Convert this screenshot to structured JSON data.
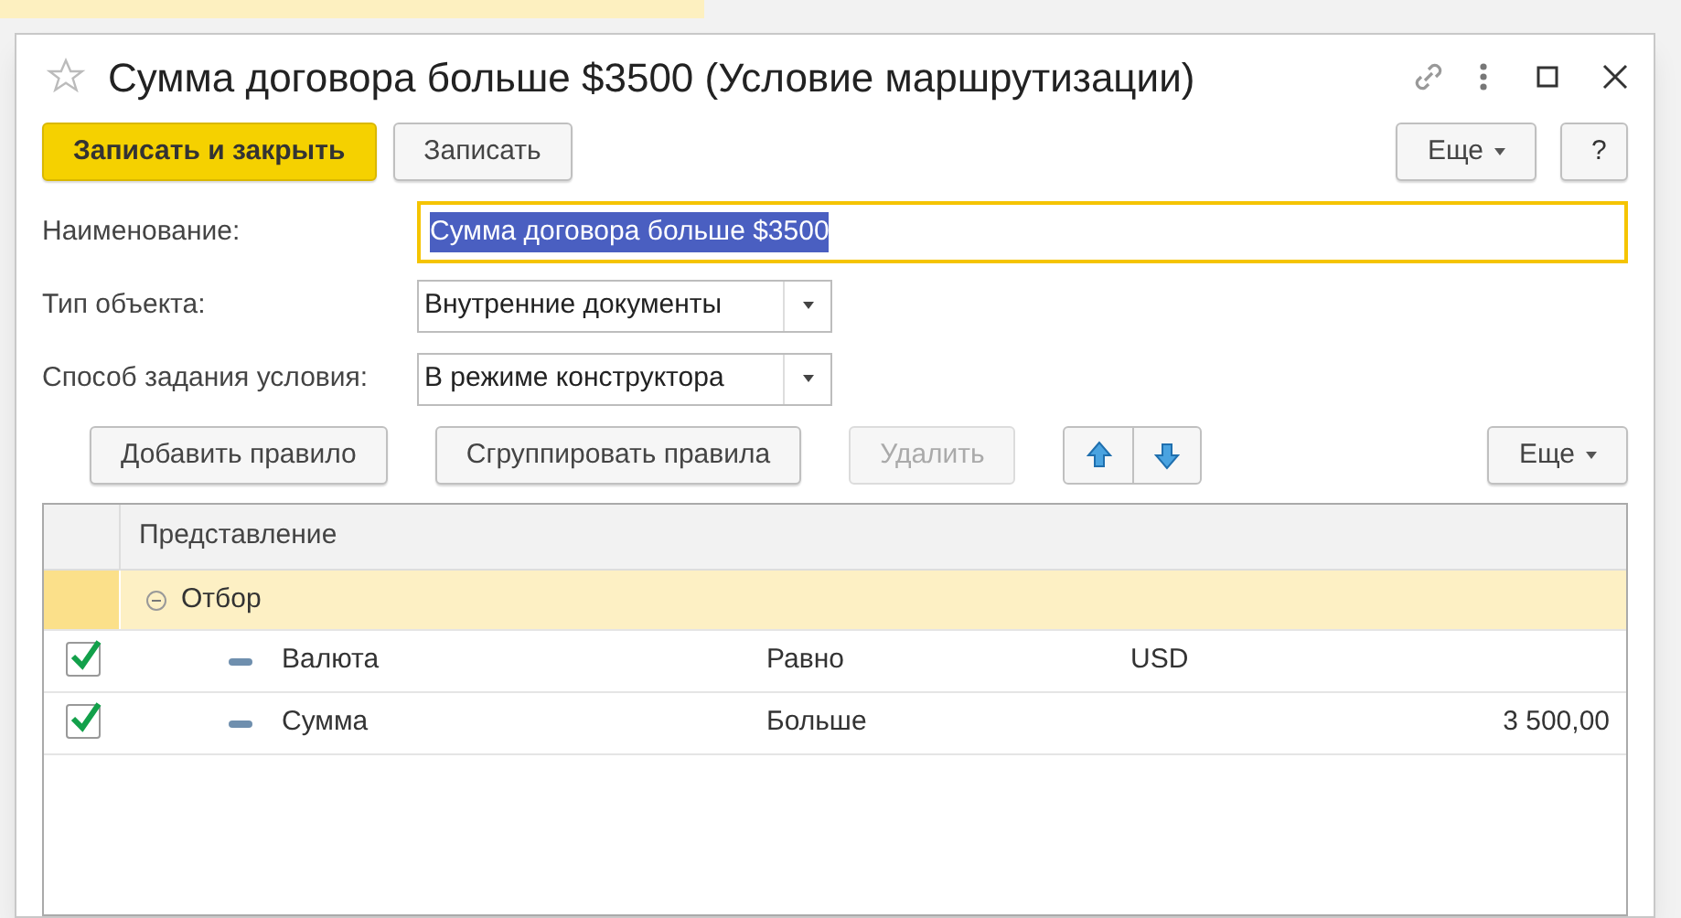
{
  "window": {
    "title": "Сумма договора больше $3500 (Условие маршрутизации)"
  },
  "toolbar": {
    "buttons": [
      {
        "label": "Записать и закрыть",
        "kind": "primary"
      },
      {
        "label": "Записать",
        "kind": "normal"
      }
    ],
    "more": "Еще",
    "help": "?"
  },
  "fields": [
    {
      "label": "Наименование:",
      "kind": "text",
      "value": "Сумма договора больше $3500",
      "focused": true
    },
    {
      "label": "Тип объекта:",
      "kind": "select",
      "value": "Внутренние документы",
      "focused": false
    },
    {
      "label": "Способ задания условия:",
      "kind": "select",
      "value": "В режиме конструктора",
      "focused": false
    }
  ],
  "rules_toolbar": {
    "buttons": [
      {
        "label": "Добавить правило",
        "disabled": false
      },
      {
        "label": "Сгруппировать правила",
        "disabled": false
      },
      {
        "label": "Удалить",
        "disabled": true
      }
    ],
    "more": "Еще"
  },
  "table": {
    "columns": [
      "Представление"
    ],
    "rows": [
      {
        "label": "Отбор",
        "expanded": true,
        "selected": true,
        "children": [
          {
            "checked": true,
            "field": "Валюта",
            "comparison": "Равно",
            "value": "USD",
            "kind": "text"
          },
          {
            "checked": true,
            "field": "Сумма",
            "comparison": "Больше",
            "value": "3 500,00",
            "kind": "number"
          }
        ]
      }
    ]
  }
}
